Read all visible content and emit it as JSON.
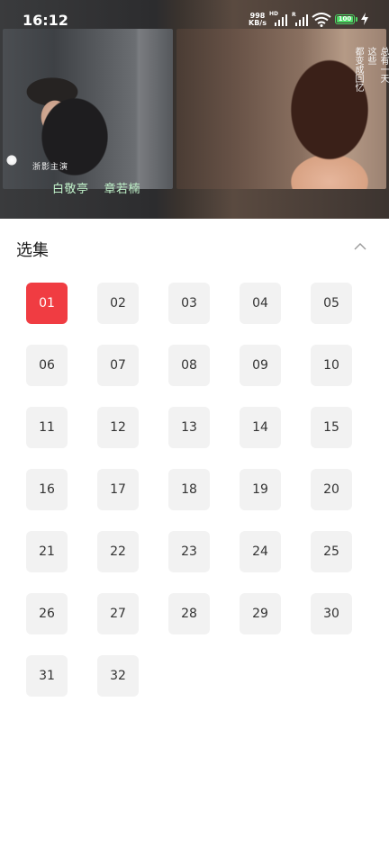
{
  "status_bar": {
    "time": "16:12",
    "net_speed_value": "998",
    "net_speed_unit": "KB/s",
    "signal_label_1": "HD",
    "signal_label_2": "R",
    "battery": "100",
    "icons": [
      "signal-icon",
      "wifi-icon",
      "battery-icon",
      "charging-icon"
    ]
  },
  "video": {
    "logo_text": "浙影主演",
    "subtitle_names": [
      "白敬亭",
      "章若楠"
    ],
    "vertical_caption": [
      "总有一天",
      "这些",
      "都变成回忆"
    ]
  },
  "episodes": {
    "title": "选集",
    "collapse_icon": "chevron-up-icon",
    "selected": "01",
    "accent_color": "#f03c42",
    "items": [
      "01",
      "02",
      "03",
      "04",
      "05",
      "06",
      "07",
      "08",
      "09",
      "10",
      "11",
      "12",
      "13",
      "14",
      "15",
      "16",
      "17",
      "18",
      "19",
      "20",
      "21",
      "22",
      "23",
      "24",
      "25",
      "26",
      "27",
      "28",
      "29",
      "30",
      "31",
      "32"
    ]
  }
}
